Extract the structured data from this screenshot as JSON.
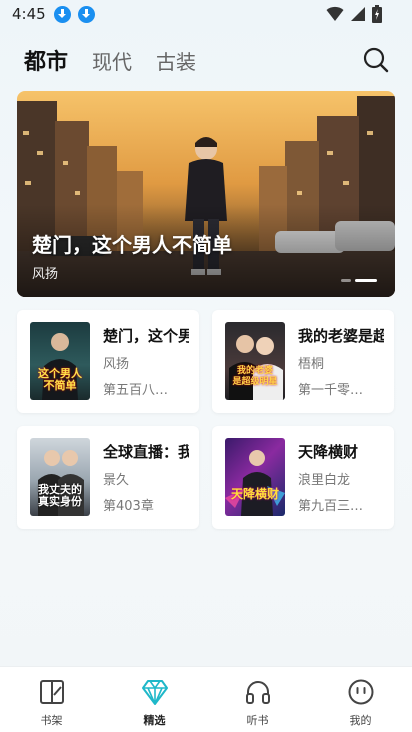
{
  "status_bar": {
    "time": "4:45"
  },
  "tabs": [
    {
      "label": "都市",
      "active": true
    },
    {
      "label": "现代",
      "active": false
    },
    {
      "label": "古装",
      "active": false
    }
  ],
  "banner": {
    "title": "楚门，这个男人不简单",
    "author": "风扬"
  },
  "books": [
    {
      "title": "楚门，这个男人不简单",
      "author": "风扬",
      "chapter": "第五百八…"
    },
    {
      "title": "我的老婆是超级明星",
      "author": "梧桐",
      "chapter": "第一千零…"
    },
    {
      "title": "全球直播：我丈夫的真实身份",
      "author": "景久",
      "chapter": "第403章"
    },
    {
      "title": "天降横财",
      "author": "浪里白龙",
      "chapter": "第九百三…"
    }
  ],
  "covers": {
    "c1": {
      "line1": "这个男人",
      "line2": "不简单"
    },
    "c2": {
      "line1": "我的老婆",
      "line2": "是超级明星"
    },
    "c3": {
      "line1": "我丈夫的",
      "line2": "真实身份"
    },
    "c4": {
      "line1": "天降横财"
    }
  },
  "nav": [
    {
      "label": "书架",
      "icon": "bookshelf-icon"
    },
    {
      "label": "精选",
      "icon": "diamond-icon",
      "active": true
    },
    {
      "label": "听书",
      "icon": "headphones-icon"
    },
    {
      "label": "我的",
      "icon": "smiley-profile-icon"
    }
  ],
  "colors": {
    "accent": "#1fb8c9",
    "download": "#1a8ff0"
  }
}
